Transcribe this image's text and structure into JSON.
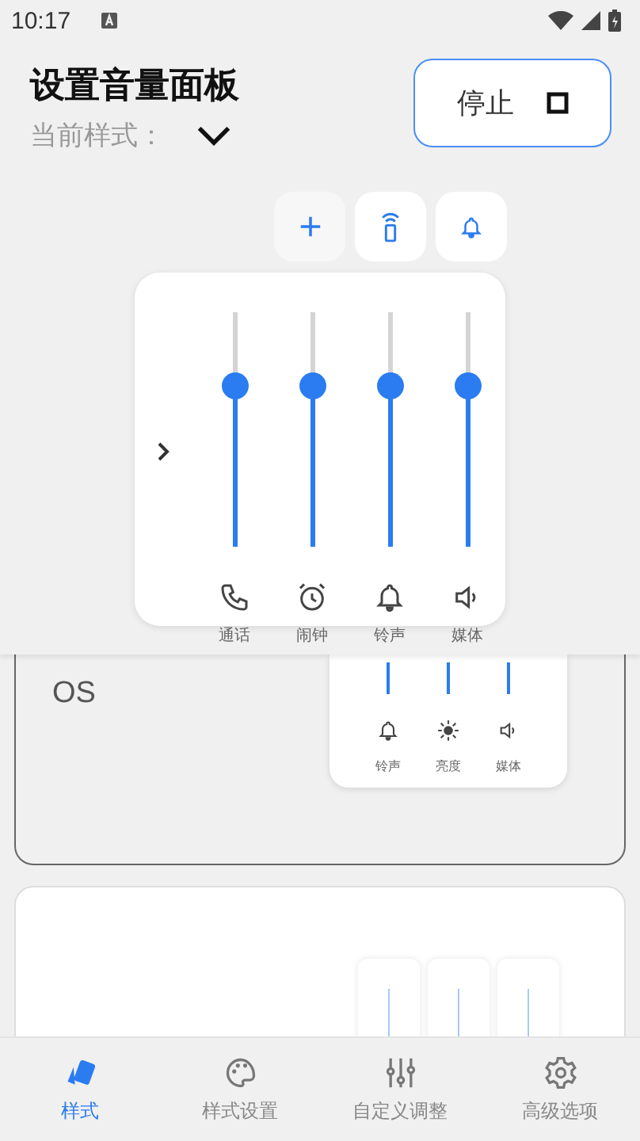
{
  "status_bar": {
    "time": "10:17"
  },
  "header": {
    "title": "设置音量面板",
    "style_label": "当前样式：",
    "stop_button": "停止"
  },
  "quick_buttons": [
    {
      "kind": "add"
    },
    {
      "kind": "remote"
    },
    {
      "kind": "bell"
    }
  ],
  "panel": {
    "sliders": [
      {
        "kind": "phone",
        "label": "通话",
        "level": 0.68
      },
      {
        "kind": "alarm",
        "label": "闹钟",
        "level": 0.68
      },
      {
        "kind": "bell",
        "label": "铃声",
        "level": 0.68
      },
      {
        "kind": "media",
        "label": "媒体",
        "level": 0.68
      }
    ]
  },
  "styles": [
    {
      "title": "OS",
      "selected": true,
      "preview": [
        {
          "kind": "bell",
          "label": "铃声"
        },
        {
          "kind": "brightness",
          "label": "亮度"
        },
        {
          "kind": "media",
          "label": "媒体"
        }
      ]
    },
    {
      "selected": false,
      "preview": [
        {
          "kind": "slider"
        },
        {
          "kind": "slider"
        },
        {
          "kind": "slider"
        }
      ]
    }
  ],
  "bottom_nav": [
    {
      "kind": "style",
      "label": "样式",
      "selected": true
    },
    {
      "kind": "palette",
      "label": "样式设置",
      "selected": false
    },
    {
      "kind": "tune",
      "label": "自定义调整",
      "selected": false
    },
    {
      "kind": "gear",
      "label": "高级选项",
      "selected": false
    }
  ]
}
